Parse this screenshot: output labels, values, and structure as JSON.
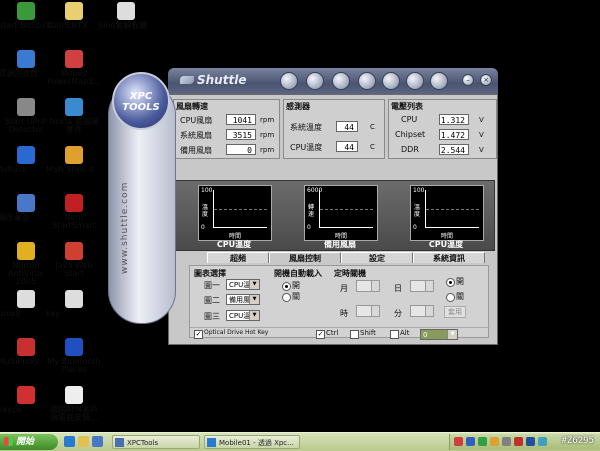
{
  "desktop": {
    "icons_col1": [
      {
        "label": "Start BitSpirit",
        "color": "#3a9a3a"
      },
      {
        "label": "資源回收筒",
        "color": "#3a7ad0"
      },
      {
        "label": "Start UPnP Detector",
        "color": "#888888"
      },
      {
        "label": "AvRack",
        "color": "#2a6ad0"
      },
      {
        "label": "顯示桌面",
        "color": "#4a78c8"
      },
      {
        "label": "Norton AntiVirus 2005",
        "color": "#e0b020"
      },
      {
        "label": "proxy",
        "color": "#dddddd"
      },
      {
        "label": "MultiProxy",
        "color": "#c83030"
      },
      {
        "label": "Skype",
        "color": "#d03030"
      }
    ],
    "icons_col2": [
      {
        "label": "100PENTX",
        "color": "#e8d070"
      },
      {
        "label": "Mobey PowerMap3...",
        "color": "#d04040"
      },
      {
        "label": "Nokia 電腦端套件",
        "color": "#3a8ad0"
      },
      {
        "label": "MSN Shell 4",
        "color": "#e0a030"
      },
      {
        "label": "Nero StartSmart",
        "color": "#c02020"
      },
      {
        "label": "Java Web Start",
        "color": "#d04030"
      },
      {
        "label": "key",
        "color": "#dddddd"
      },
      {
        "label": "My Bluetooth Places",
        "color": "#2050c0"
      },
      {
        "label": "網路ATM客戶端電腦安裝...",
        "color": "#eeeeee"
      }
    ],
    "icons_col3": [
      {
        "label": "Sino繁解軟體",
        "color": "#dddddd"
      }
    ]
  },
  "app": {
    "brand": "Shuttle",
    "pill_logo": "XPC TOOLS",
    "pill_site": "www.shuttle.com",
    "fan_speed": {
      "title": "風扇轉速",
      "rows": [
        {
          "label": "CPU風扇",
          "value": "1041",
          "unit": "rpm"
        },
        {
          "label": "系統風扇",
          "value": "3515",
          "unit": "rpm"
        },
        {
          "label": "備用風扇",
          "value": "0",
          "unit": "rpm"
        }
      ]
    },
    "sensors": {
      "title": "感測器",
      "rows": [
        {
          "label": "系統溫度",
          "value": "44",
          "unit": "C"
        },
        {
          "label": "CPU溫度",
          "value": "44",
          "unit": "C"
        }
      ]
    },
    "voltage": {
      "title": "電壓列表",
      "rows": [
        {
          "label": "CPU",
          "value": "1.312",
          "unit": "V"
        },
        {
          "label": "Chipset",
          "value": "1.472",
          "unit": "V"
        },
        {
          "label": "DDR",
          "value": "2.544",
          "unit": "V"
        }
      ]
    },
    "graphs": [
      {
        "ymax": "100",
        "ymin": "0",
        "ylabel": "溫度",
        "xlabel": "時間",
        "caption": "CPU溫度"
      },
      {
        "ymax": "6000",
        "ymin": "0",
        "ylabel": "轉速",
        "xlabel": "時間",
        "caption": "備用風扇"
      },
      {
        "ymax": "100",
        "ymin": "0",
        "ylabel": "溫度",
        "xlabel": "時間",
        "caption": "CPU溫度"
      }
    ],
    "tabs": [
      "超頻",
      "風扇控制",
      "設定",
      "系統資訊"
    ],
    "chart_select": {
      "title": "圖表選擇",
      "rows": [
        {
          "label": "圖一",
          "value": "CPU溫"
        },
        {
          "label": "圖二",
          "value": "備用風"
        },
        {
          "label": "圖三",
          "value": "CPU溫"
        }
      ]
    },
    "autoload": {
      "title": "開機自動載入",
      "on": "開",
      "off": "關"
    },
    "timer": {
      "title": "定時關機",
      "month": "月",
      "day": "日",
      "hour": "時",
      "minute": "分",
      "on": "開",
      "off": "關",
      "apply": "套用"
    },
    "hotkey": {
      "label": "Optical Drive Hot Key",
      "ctrl": "Ctrl",
      "shift": "Shift",
      "alt": "Alt",
      "key_value": "0"
    }
  },
  "taskbar": {
    "start": "開始",
    "tasks": [
      "XPCTools",
      "Mobile01 - 透過 Xpc..."
    ],
    "clock": "#Z6295"
  }
}
